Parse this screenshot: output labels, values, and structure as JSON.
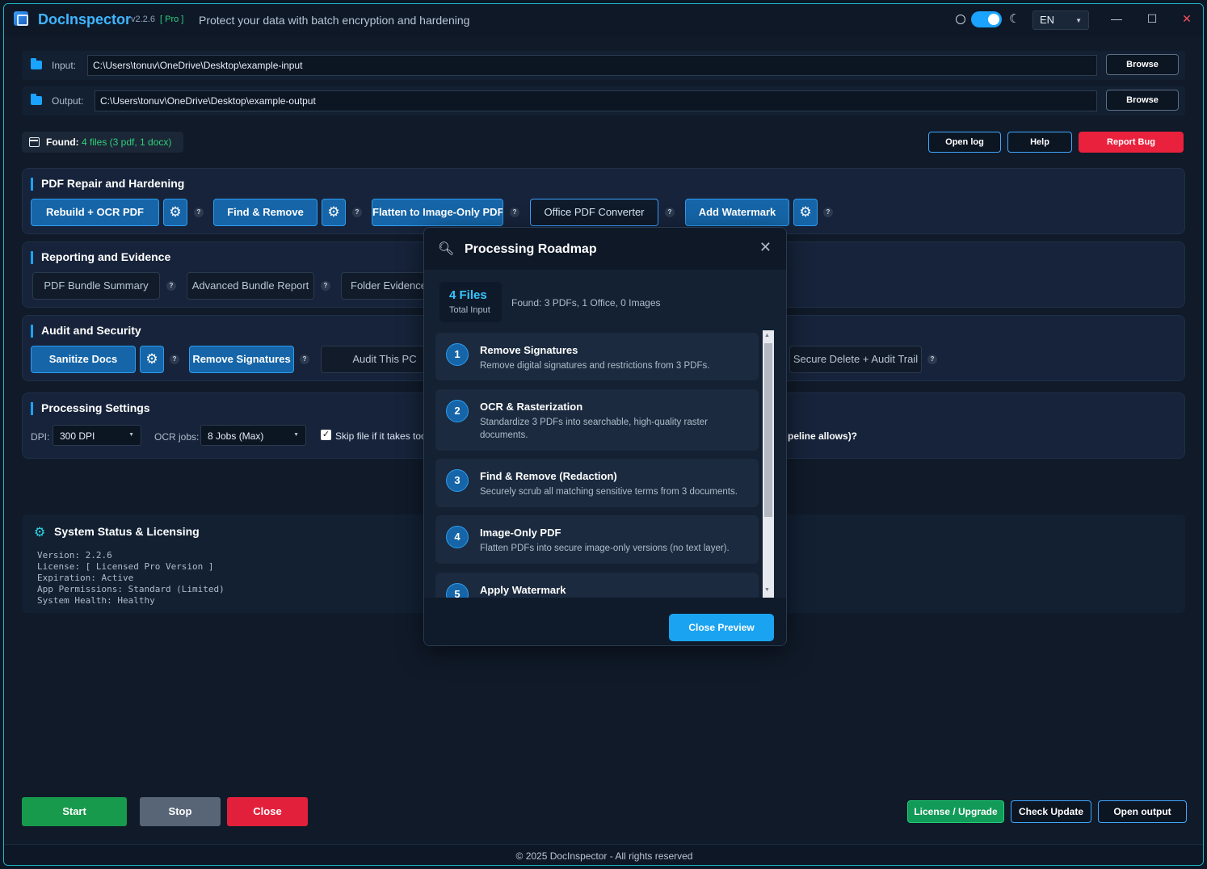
{
  "app": {
    "title": "DocInspector",
    "version": "v2.2.6",
    "edition": "[ Pro ]",
    "tagline": "Protect your data with batch encryption and hardening",
    "language": "EN",
    "window_controls": {
      "minimize": "—",
      "maximize": "☐",
      "close": "✕"
    }
  },
  "paths": {
    "input_label": "Input:",
    "input_value": "C:\\Users\\tonuv\\OneDrive\\Desktop\\example-input",
    "output_label": "Output:",
    "output_value": "C:\\Users\\tonuv\\OneDrive\\Desktop\\example-output",
    "browse_label": "Browse"
  },
  "found": {
    "label": "Found:",
    "value": "4 files (3 pdf, 1 docx)"
  },
  "top_actions": {
    "open_log": "Open log",
    "help": "Help",
    "report_bug": "Report Bug"
  },
  "sections": {
    "pdf": {
      "title": "PDF Repair and Hardening",
      "buttons": [
        "Rebuild + OCR PDF",
        "Find & Remove",
        "Flatten to Image-Only PDF",
        "Office PDF Converter",
        "Add Watermark"
      ]
    },
    "reporting": {
      "title": "Reporting and Evidence",
      "buttons": [
        "PDF Bundle Summary",
        "Advanced Bundle Report",
        "Folder Evidence"
      ]
    },
    "audit": {
      "title": "Audit and Security",
      "buttons": [
        "Sanitize Docs",
        "Remove Signatures",
        "Audit This PC",
        "Secure Delete + Audit Trail"
      ]
    },
    "settings": {
      "title": "Processing Settings",
      "dpi_label": "DPI:",
      "dpi_value": "300 DPI",
      "ocr_label": "OCR jobs:",
      "ocr_value": "8 Jobs  (Max)",
      "skip_label": "Skip file if it takes too",
      "question_tail": "peline allows)?",
      "skip_checked": true
    }
  },
  "system_status": {
    "title": "System Status & Licensing",
    "lines": [
      "Version: 2.2.6",
      "License: [ Licensed Pro Version ]",
      "Expiration: Active",
      "App Permissions: Standard (Limited)",
      "System Health: Healthy"
    ]
  },
  "bottom": {
    "start": "Start",
    "stop": "Stop",
    "close": "Close",
    "license": "License / Upgrade",
    "check_update": "Check Update",
    "open_output": "Open output"
  },
  "footer": "© 2025 DocInspector - All rights reserved",
  "modal": {
    "title": "Processing Roadmap",
    "files_count": "4 Files",
    "files_sub": "Total Input",
    "found_text": "Found: 3 PDFs, 1 Office, 0 Images",
    "steps": [
      {
        "num": "1",
        "title": "Remove Signatures",
        "desc": "Remove digital signatures and restrictions from 3 PDFs."
      },
      {
        "num": "2",
        "title": "OCR & Rasterization",
        "desc": "Standardize 3 PDFs into searchable, high-quality raster documents."
      },
      {
        "num": "3",
        "title": "Find & Remove (Redaction)",
        "desc": "Securely scrub all matching sensitive terms from 3 documents."
      },
      {
        "num": "4",
        "title": "Image-Only PDF",
        "desc": "Flatten PDFs into secure image-only versions (no text layer)."
      },
      {
        "num": "5",
        "title": "Apply Watermark",
        "desc": ""
      }
    ],
    "close_preview": "Close Preview"
  },
  "colors": {
    "accent": "#1aa3ff",
    "brand": "#3fb5ff",
    "success": "#2fd07a",
    "danger": "#e9213d",
    "background": "#101a29"
  }
}
